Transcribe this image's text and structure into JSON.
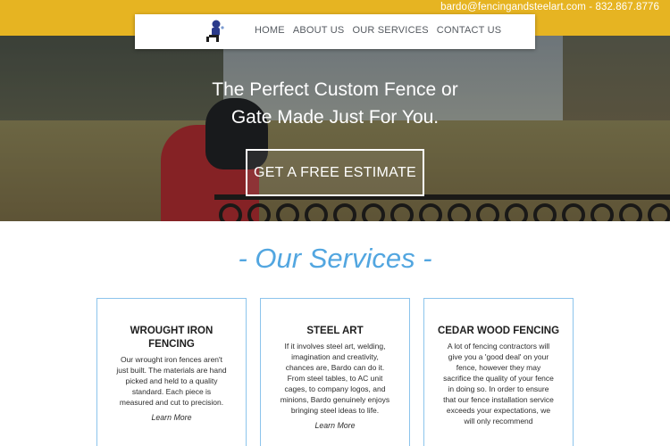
{
  "header": {
    "contact": "bardo@fencingandsteelart.com - 832.867.8776"
  },
  "nav": {
    "items": [
      {
        "label": "HOME"
      },
      {
        "label": "ABOUT US"
      },
      {
        "label": "OUR SERVICES"
      },
      {
        "label": "CONTACT US"
      }
    ]
  },
  "hero": {
    "headline_line1": "The Perfect Custom Fence or",
    "headline_line2": "Gate Made Just For You.",
    "cta_label": "GET A FREE ESTIMATE"
  },
  "services": {
    "title": "- Our Services -",
    "cards": [
      {
        "title": "WROUGHT IRON FENCING",
        "body": "Our wrought iron fences aren't just built. The materials are hand picked and held to a quality standard. Each piece is measured and cut to precision.",
        "link": "Learn More"
      },
      {
        "title": "STEEL ART",
        "body": "If it involves steel art, welding, imagination and creativity, chances are, Bardo can do it. From steel tables, to AC unit cages, to company logos, and minions, Bardo genuinely enjoys bringing steel ideas to life.",
        "link": "Learn More"
      },
      {
        "title": "CEDAR WOOD FENCING",
        "body": "A lot of fencing contractors will give you a 'good deal' on your fence, however they may sacrifice the quality of your fence in doing so. In order to ensure that our fence installation service exceeds your expectations, we will only recommend",
        "link": ""
      }
    ]
  },
  "colors": {
    "topbar": "#e6b422",
    "accent": "#52a6e0",
    "card_border": "#8cc4ec"
  }
}
